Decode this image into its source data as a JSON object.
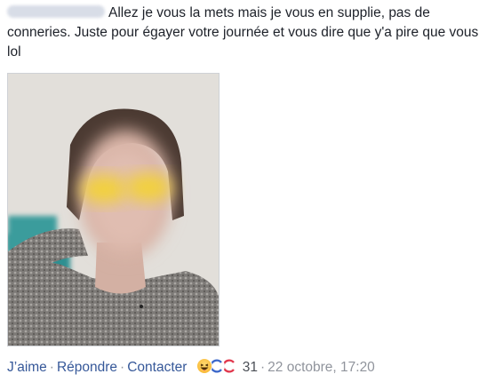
{
  "comment": {
    "text": "Allez je vous la mets mais je vous en supplie, pas de conneries. Juste pour égayer votre journée et vous dire que y'a pire que vous lol"
  },
  "actions": {
    "like": "J’aime",
    "reply": "Répondre",
    "contact": "Contacter",
    "separator": "·",
    "reaction_count": "31",
    "timestamp": "22 octobre, 17:20"
  },
  "reactions": {
    "icons": [
      "haha-icon",
      "wow-icon",
      "sad-icon"
    ]
  },
  "colors": {
    "link": "#365899",
    "muted": "#90949c",
    "text": "#1d2129"
  }
}
